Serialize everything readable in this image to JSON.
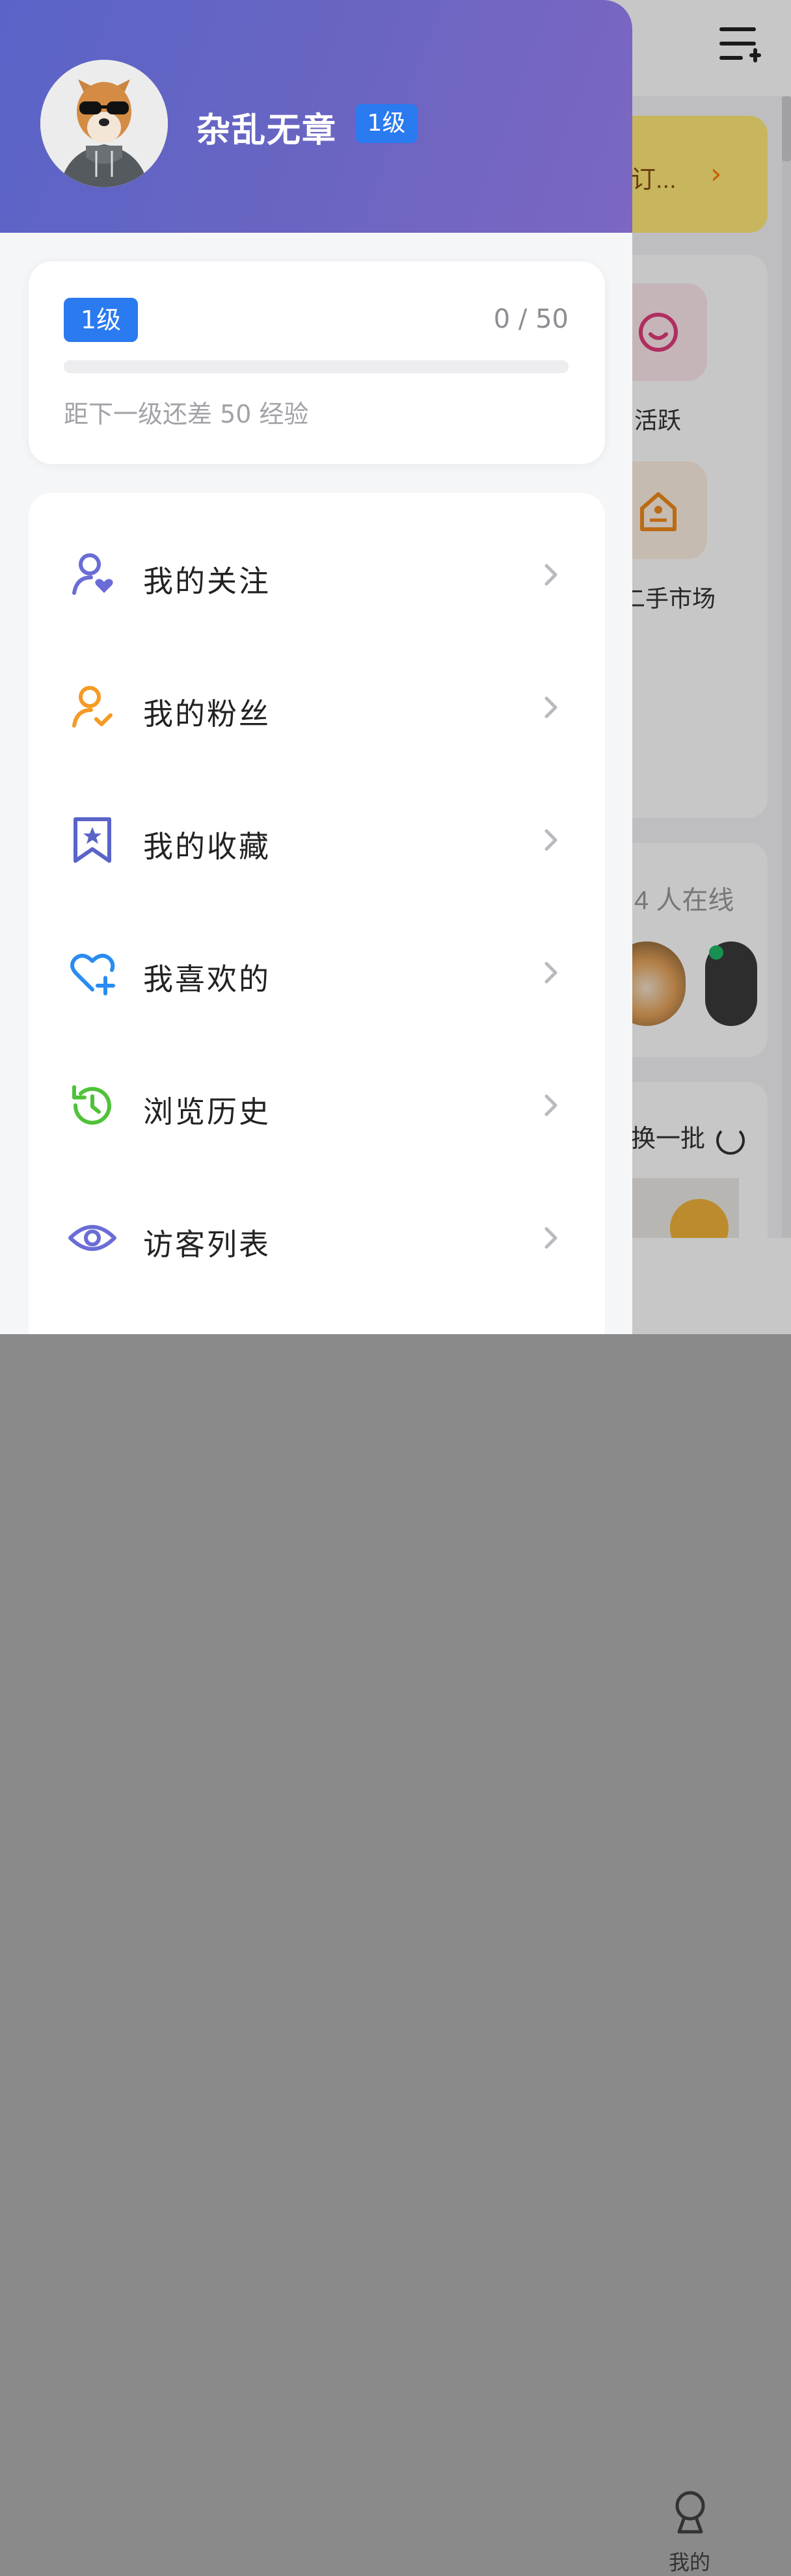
{
  "background": {
    "promo_text": "订...",
    "tiles": [
      {
        "label": "活跃"
      },
      {
        "label": "二手市场"
      }
    ],
    "online_text": "4 人在线",
    "swap_text": "换一批",
    "tab_label": "我的"
  },
  "drawer": {
    "username": "杂乱无章",
    "level_badge": "1级",
    "level_card": {
      "badge": "1级",
      "progress_text": "0 / 50",
      "progress_fraction": 0,
      "next_level_text": "距下一级还差 50 经验"
    },
    "menu": [
      {
        "label": "我的关注",
        "icon": "follow-user-heart-icon",
        "color": "#6a6dd6"
      },
      {
        "label": "我的粉丝",
        "icon": "fans-user-check-icon",
        "color": "#f59a23"
      },
      {
        "label": "我的收藏",
        "icon": "bookmark-star-icon",
        "color": "#5a64c8"
      },
      {
        "label": "我喜欢的",
        "icon": "heart-plus-icon",
        "color": "#2a8cf0"
      },
      {
        "label": "浏览历史",
        "icon": "history-clock-icon",
        "color": "#4fc23a"
      },
      {
        "label": "访客列表",
        "icon": "eye-icon",
        "color": "#6a6dd6"
      }
    ]
  },
  "colors": {
    "header_gradient_start": "#5a64c8",
    "header_gradient_end": "#7c67c2",
    "badge_blue": "#2a7af0"
  }
}
